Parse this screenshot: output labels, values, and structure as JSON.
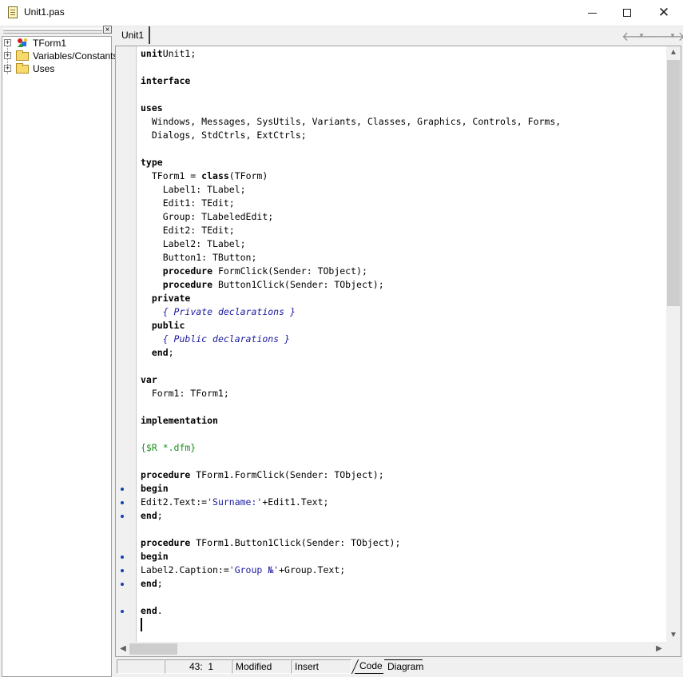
{
  "window": {
    "title": "Unit1.pas",
    "minimize_label": "",
    "maximize_label": "",
    "close_label": "✕"
  },
  "explorer": {
    "close_label": "×",
    "items": [
      {
        "label": "TForm1",
        "expander": "+"
      },
      {
        "label": "Variables/Constants",
        "expander": "+"
      },
      {
        "label": "Uses",
        "expander": "+"
      }
    ]
  },
  "editor": {
    "tab_label": "Unit1",
    "nav_back": "🡐",
    "nav_forward": "🡒",
    "code_lines": [
      [
        [
          "kw",
          "unit"
        ],
        [
          "",
          "Unit1;"
        ]
      ],
      [],
      [
        [
          "kw",
          "interface"
        ]
      ],
      [],
      [
        [
          "kw",
          "uses"
        ]
      ],
      [
        [
          "",
          "  Windows, Messages, SysUtils, Variants, Classes, Graphics, Controls, Forms,"
        ]
      ],
      [
        [
          "",
          "  Dialogs, StdCtrls, ExtCtrls;"
        ]
      ],
      [],
      [
        [
          "kw",
          "type"
        ]
      ],
      [
        [
          "",
          "  TForm1 = "
        ],
        [
          "kw",
          "class"
        ],
        [
          "",
          "(TForm)"
        ]
      ],
      [
        [
          "",
          "    Label1: TLabel;"
        ]
      ],
      [
        [
          "",
          "    Edit1: TEdit;"
        ]
      ],
      [
        [
          "",
          "    Group: TLabeledEdit;"
        ]
      ],
      [
        [
          "",
          "    Edit2: TEdit;"
        ]
      ],
      [
        [
          "",
          "    Label2: TLabel;"
        ]
      ],
      [
        [
          "",
          "    Button1: TButton;"
        ]
      ],
      [
        [
          "",
          "    "
        ],
        [
          "kw",
          "procedure"
        ],
        [
          "",
          " FormClick(Sender: TObject);"
        ]
      ],
      [
        [
          "",
          "    "
        ],
        [
          "kw",
          "procedure"
        ],
        [
          "",
          " Button1Click(Sender: TObject);"
        ]
      ],
      [
        [
          "",
          "  "
        ],
        [
          "kw",
          "private"
        ]
      ],
      [
        [
          "",
          "    "
        ],
        [
          "com",
          "{ Private declarations }"
        ]
      ],
      [
        [
          "",
          "  "
        ],
        [
          "kw",
          "public"
        ]
      ],
      [
        [
          "",
          "    "
        ],
        [
          "com",
          "{ Public declarations }"
        ]
      ],
      [
        [
          "",
          "  "
        ],
        [
          "kw",
          "end"
        ],
        [
          "",
          ";"
        ]
      ],
      [],
      [
        [
          "kw",
          "var"
        ]
      ],
      [
        [
          "",
          "  Form1: TForm1;"
        ]
      ],
      [],
      [
        [
          "kw",
          "implementation"
        ]
      ],
      [],
      [
        [
          "dir",
          "{$R *.dfm}"
        ]
      ],
      [],
      [
        [
          "kw",
          "procedure"
        ],
        [
          "",
          " TForm1.FormClick(Sender: TObject);"
        ]
      ],
      [
        [
          "kw",
          "begin"
        ]
      ],
      [
        [
          "",
          "Edit2.Text:="
        ],
        [
          "str",
          "'Surname:'"
        ],
        [
          "",
          "+Edit1.Text;"
        ]
      ],
      [
        [
          "kw",
          "end"
        ],
        [
          "",
          ";"
        ]
      ],
      [],
      [
        [
          "kw",
          "procedure"
        ],
        [
          "",
          " TForm1.Button1Click(Sender: TObject);"
        ]
      ],
      [
        [
          "kw",
          "begin"
        ]
      ],
      [
        [
          "",
          "Label2.Caption:="
        ],
        [
          "str",
          "'Group №'"
        ],
        [
          "",
          "+Group.Text;"
        ]
      ],
      [
        [
          "kw",
          "end"
        ],
        [
          "",
          ";"
        ]
      ],
      [],
      [
        [
          "kw",
          "end"
        ],
        [
          "",
          "."
        ]
      ],
      []
    ],
    "breakpoint_dot_lines": [
      32,
      33,
      34,
      37,
      38,
      39,
      41
    ],
    "scroll_up": "▲",
    "scroll_down": "▼",
    "scroll_left": "◀",
    "scroll_right": "▶"
  },
  "status": {
    "position": "43:  1",
    "modified": "Modified",
    "mode": "Insert",
    "tab_code": "Code",
    "tab_diagram": "Diagram"
  },
  "colors": {
    "keyword": "#000000",
    "comment": "#1a1aa0",
    "directive": "#1c8f1c",
    "string": "#1a1aa0",
    "breakpoint_dot": "#1a3fb0"
  }
}
